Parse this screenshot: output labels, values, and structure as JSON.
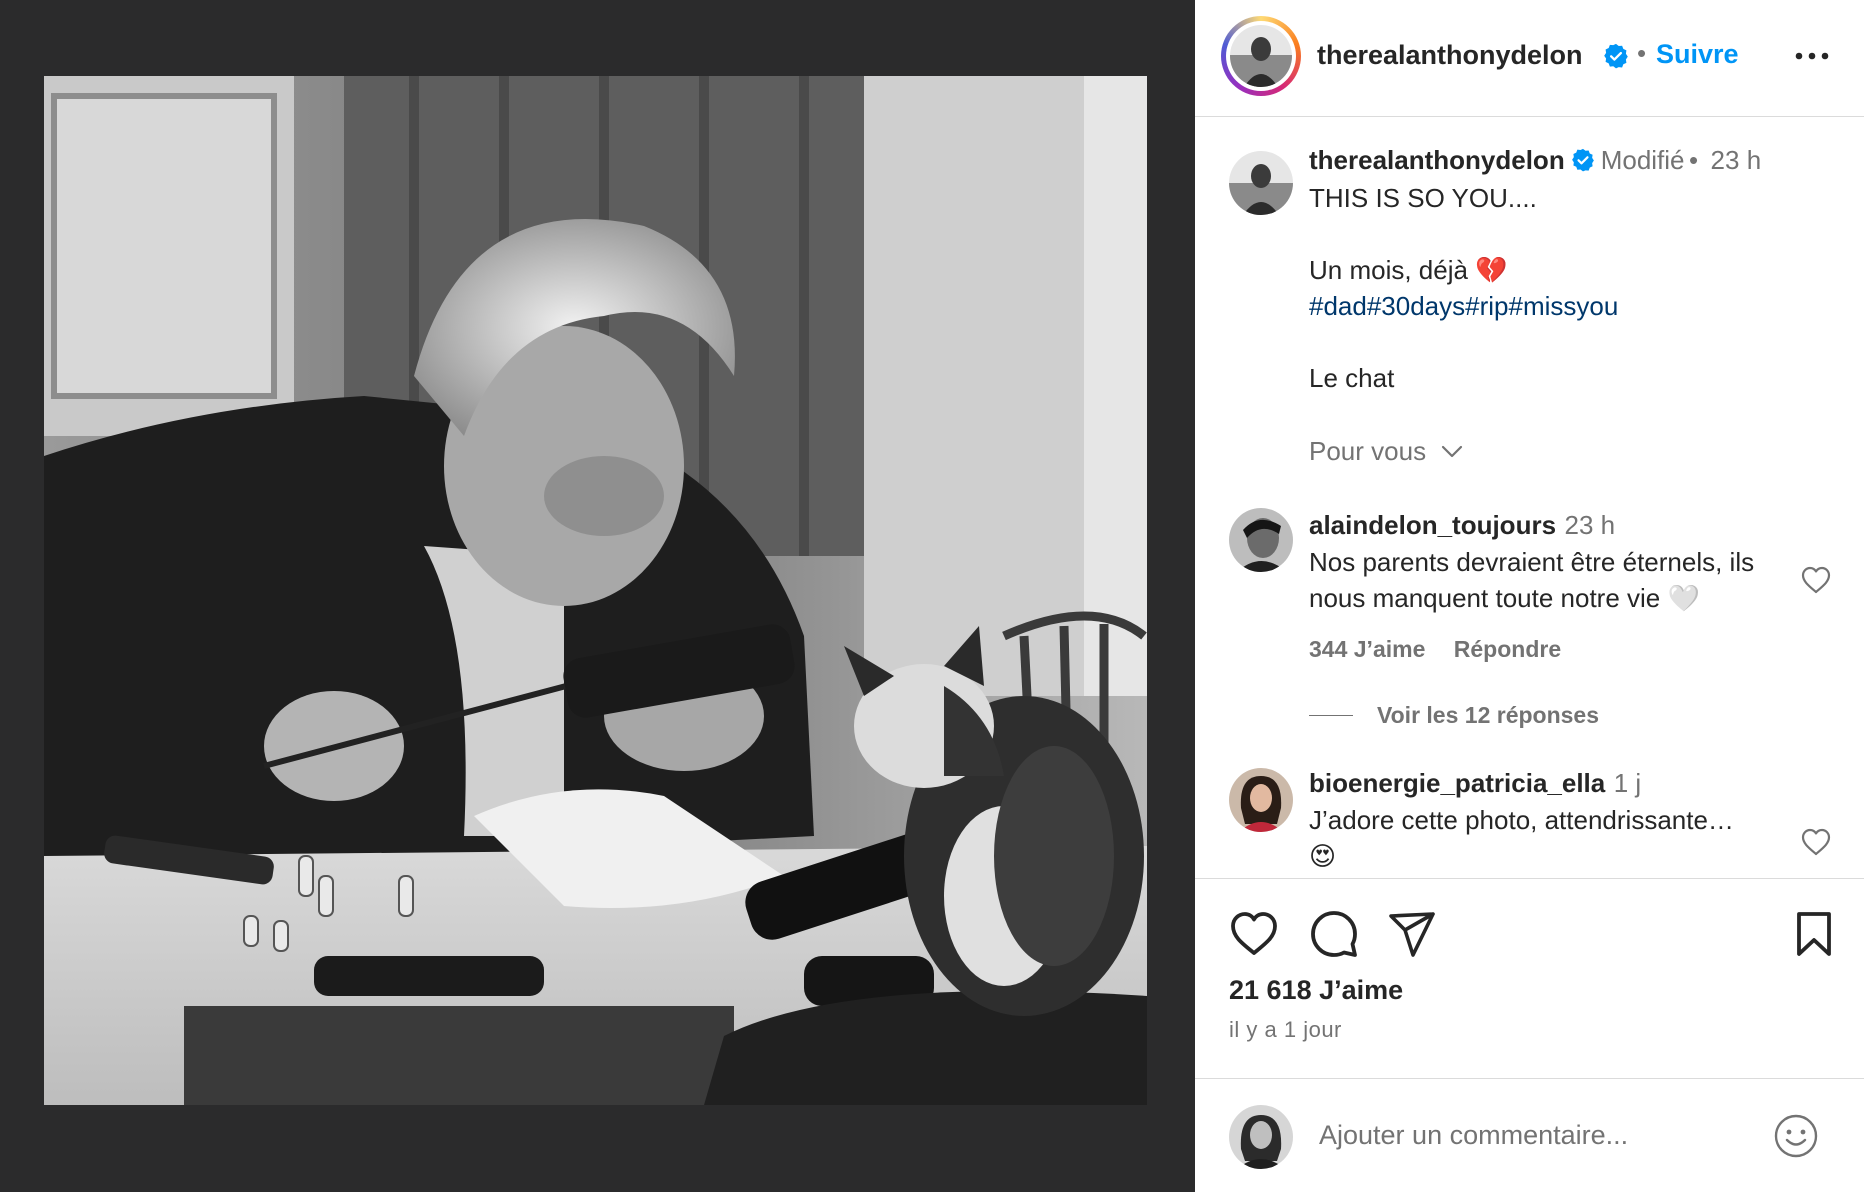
{
  "post_author": {
    "username": "therealanthonydelon",
    "follow_label": "Suivre",
    "separator": "•"
  },
  "caption": {
    "username": "therealanthonydelon",
    "edited_label": "Modifié",
    "dot": "•",
    "time": "23 h",
    "line1": "THIS IS SO YOU....",
    "line2": "Un mois, déjà",
    "broken_heart": "💔",
    "hashtags": "#dad#30days#rip#missyou",
    "line4": "Le chat"
  },
  "pour_vous": "Pour vous",
  "comments": [
    {
      "username": "alaindelon_toujours",
      "time": "23 h",
      "text": "Nos parents devraient être éternels, ils nous manquent toute notre vie 🤍",
      "likes": "344 J’aime",
      "reply_label": "Répondre",
      "view_replies": "Voir les 12 réponses"
    },
    {
      "username": "bioenergie_patricia_ella",
      "time": "1 j",
      "text": "J’adore cette photo, attendrissante…",
      "emoji": "😍"
    }
  ],
  "actions": {
    "likes_count": "21 618 J’aime",
    "time_ago": "il y a 1 jour"
  },
  "add_comment": {
    "placeholder": "Ajouter un commentaire..."
  },
  "colors": {
    "accent_blue": "#0095f6",
    "hashtag_blue": "#00376b",
    "muted": "#737373",
    "media_bg": "#2b2b2c"
  },
  "icons": {
    "verified": "verified-badge-icon",
    "more": "more-horizontal-icon",
    "like": "heart-outline-icon",
    "comment": "comment-bubble-icon",
    "share": "paper-plane-icon",
    "save": "bookmark-icon",
    "emoji": "smiley-icon",
    "chevron": "chevron-down-icon"
  }
}
